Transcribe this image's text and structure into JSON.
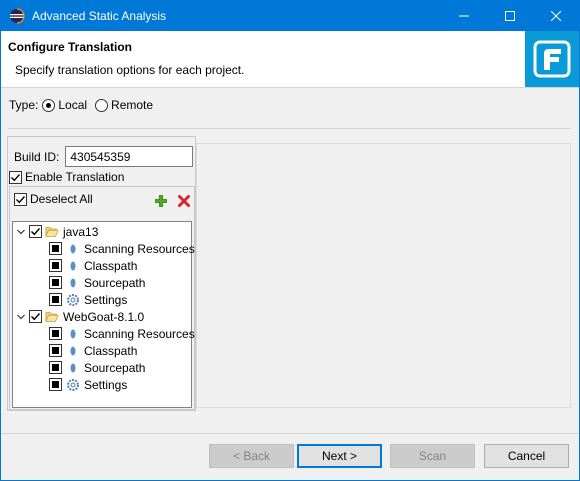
{
  "window": {
    "title": "Advanced Static Analysis"
  },
  "header": {
    "title": "Configure Translation",
    "description": "Specify translation options for each project."
  },
  "type": {
    "label": "Type:",
    "options": [
      {
        "label": "Local",
        "selected": true
      },
      {
        "label": "Remote",
        "selected": false
      }
    ]
  },
  "build": {
    "label": "Build ID:",
    "value": "430545359"
  },
  "enable_translation": {
    "label": "Enable Translation",
    "checked": true
  },
  "deselect_all": {
    "label": "Deselect All",
    "checked": true
  },
  "tree": {
    "projects": [
      {
        "name": "java13",
        "checked": true,
        "children": [
          "Scanning Resources",
          "Classpath",
          "Sourcepath",
          "Settings"
        ]
      },
      {
        "name": "WebGoat-8.1.0",
        "checked": true,
        "children": [
          "Scanning Resources",
          "Classpath",
          "Sourcepath",
          "Settings"
        ]
      }
    ]
  },
  "buttons": {
    "back": "< Back",
    "next": "Next >",
    "scan": "Scan",
    "cancel": "Cancel"
  },
  "colors": {
    "accent": "#0078d7",
    "logo_bg": "#0a9ad7",
    "add": "#4caf1a",
    "remove": "#d9262b"
  }
}
